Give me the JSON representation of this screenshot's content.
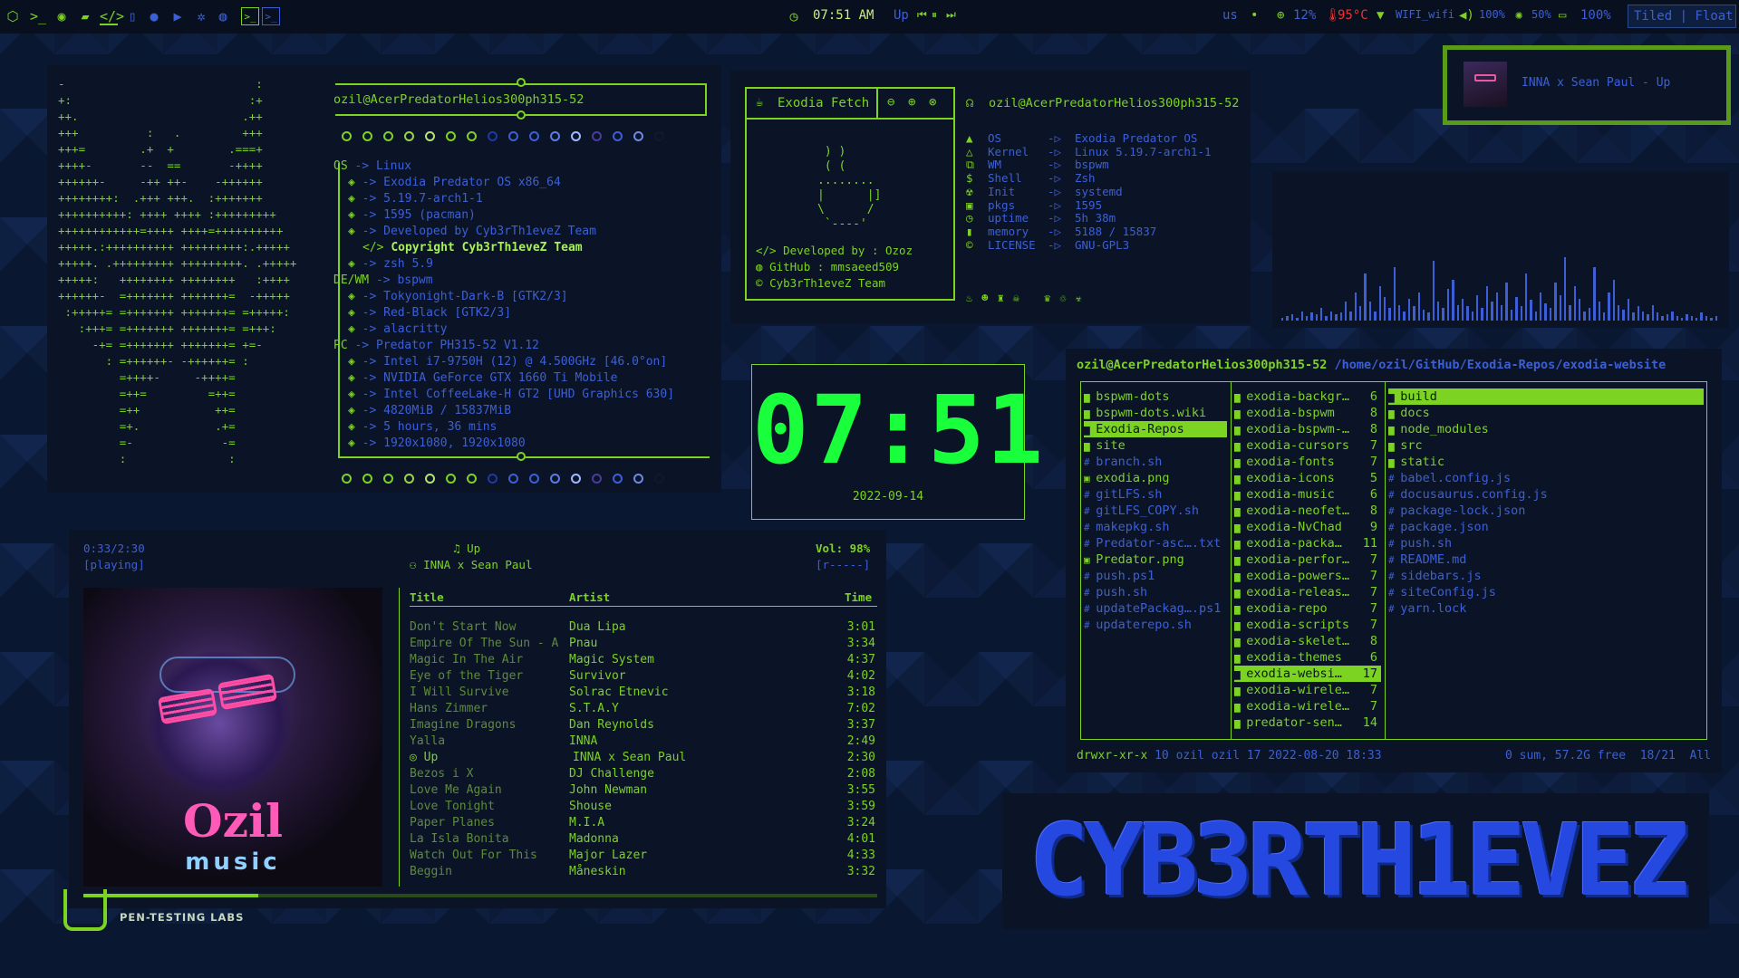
{
  "topbar": {
    "time": "07:51 AM",
    "media_title": "Up",
    "keyboard": "us",
    "cpu": "12%",
    "temp": "95°C",
    "wifi": "WIFI_wifi",
    "volume": "100%",
    "brightness": "50%",
    "battery": "100%",
    "layout_tiled": "Tiled",
    "layout_float": "Float",
    "layout_sep": "|"
  },
  "now_playing_popup": {
    "title": "INNA x Sean Paul - Up"
  },
  "neofetch": {
    "user_host": "ozil@AcerPredatorHelios300ph315-52",
    "os_label": "OS",
    "os_value": "-> Linux",
    "os_items": [
      "-> Exodia Predator OS x86_64",
      "-> 5.19.7-arch1-1",
      "-> 1595 (pacman)",
      "-> Developed by Cyb3rTh1eveZ Team",
      "Copyright Cyb3rTh1eveZ Team",
      "-> zsh 5.9"
    ],
    "de_label": "DE/WM",
    "de_value": "-> bspwm",
    "de_items": [
      "-> Tokyonight-Dark-B [GTK2/3]",
      "-> Red-Black [GTK2/3]",
      "-> alacritty"
    ],
    "pc_label": "PC",
    "pc_value": "-> Predator PH315-52 V1.12",
    "pc_items": [
      "-> Intel i7-9750H (12) @ 4.500GHz [46.0°on]",
      "-> NVIDIA GeForce GTX 1660 Ti Mobile",
      "-> Intel CoffeeLake-H GT2 [UHD Graphics 630]",
      "-> 4820MiB / 15837MiB",
      "-> 5 hours, 36 mins",
      "-> 1920x1080, 1920x1080"
    ],
    "ascii": [
      "-                            :",
      "+:                          :+",
      "++.                        .++",
      "+++          :   .         +++",
      "+++=        .+  +        .===+",
      "++++-       --  ==       -++++",
      "++++++-     -++ ++-    -++++++",
      "++++++++:  .+++ +++.  :+++++++",
      "++++++++++: ++++ ++++ :+++++++++",
      "++++++++++++=++++ ++++=++++++++++",
      "+++++.:++++++++++ +++++++++:.+++++",
      "+++++. .+++++++++ +++++++++. .+++++",
      "+++++:   ++++++++ ++++++++   :++++",
      "++++++-  =+++++++ +++++++=  -+++++",
      " :+++++= =+++++++ +++++++= =+++++:",
      "   :+++= =+++++++ +++++++= =+++:",
      "     -+= =+++++++ +++++++= +=-",
      "       : =++++++- -++++++= :",
      "         =++++-     -++++=",
      "         =++=         =++=",
      "         =++           ++=",
      "         =+.           .+=",
      "         =-             -=",
      "         :               :"
    ]
  },
  "exodia_fetch": {
    "title": "Exodia Fetch",
    "art": [
      " ) )",
      " ( (",
      "........",
      "|      |]",
      "\\      /",
      " `----'"
    ],
    "dev_label": "Developed by : Ozoz",
    "github_label": "GitHub : mmsaeed509",
    "team_label": "Cyb3rTh1eveZ Team",
    "user_host": "ozil@AcerPredatorHelios300ph315-52",
    "rows": [
      {
        "key": "OS",
        "val": "Exodia Predator OS"
      },
      {
        "key": "Kernel",
        "val": "Linux 5.19.7-arch1-1"
      },
      {
        "key": "WM",
        "val": "bspwm"
      },
      {
        "key": "Shell",
        "val": "Zsh"
      },
      {
        "key": "Init",
        "val": "systemd"
      },
      {
        "key": "pkgs",
        "val": "1595"
      },
      {
        "key": "uptime",
        "val": "5h 38m"
      },
      {
        "key": "memory",
        "val": "5188 / 15837"
      },
      {
        "key": "LICENSE",
        "val": "GNU-GPL3"
      }
    ],
    "arrow": "-▷"
  },
  "clock": {
    "time": "07:51",
    "date": "2022-09-14"
  },
  "visualizer": {
    "bars": [
      2,
      3,
      4,
      2,
      6,
      3,
      5,
      4,
      8,
      3,
      6,
      4,
      5,
      12,
      6,
      18,
      9,
      30,
      12,
      6,
      22,
      15,
      8,
      34,
      10,
      6,
      14,
      9,
      18,
      7,
      5,
      38,
      12,
      8,
      20,
      26,
      10,
      14,
      9,
      6,
      16,
      8,
      22,
      12,
      18,
      10,
      24,
      7,
      15,
      9,
      30,
      13,
      6,
      18,
      11,
      8,
      24,
      16,
      40,
      10,
      22,
      14,
      6,
      8,
      34,
      12,
      5,
      18,
      26,
      10,
      7,
      14,
      5,
      9,
      6,
      4,
      10,
      5,
      3,
      4,
      6,
      3,
      2,
      4,
      3,
      2,
      5,
      3,
      2,
      3
    ]
  },
  "player": {
    "position": "0:33/2:30",
    "state": "[playing]",
    "song": "Up",
    "artist": "INNA x Sean Paul",
    "volume": "Vol: 98%",
    "mode": "[r-----]",
    "col_title": "Title",
    "col_artist": "Artist",
    "col_time": "Time",
    "progress": 0.22,
    "songs": [
      {
        "title": "Don't Start Now",
        "artist": "Dua Lipa",
        "time": "3:01"
      },
      {
        "title": "Empire Of The Sun - A",
        "artist": "Pnau",
        "time": "3:34"
      },
      {
        "title": "Magic In The Air",
        "artist": "Magic System",
        "time": "4:37"
      },
      {
        "title": "Eye of the Tiger",
        "artist": "Survivor",
        "time": "4:02"
      },
      {
        "title": "I Will Survive",
        "artist": "Solrac Etnevic",
        "time": "3:18"
      },
      {
        "title": "Hans Zimmer",
        "artist": "S.T.A.Y",
        "time": "7:02"
      },
      {
        "title": "Imagine Dragons",
        "artist": "Dan Reynolds",
        "time": "3:37"
      },
      {
        "title": "Yalla",
        "artist": "INNA",
        "time": "2:49"
      },
      {
        "title": "Up",
        "artist": "INNA x Sean Paul",
        "time": "2:30"
      },
      {
        "title": "Bezos i X",
        "artist": "DJ Challenge",
        "time": "2:08"
      },
      {
        "title": "Love Me Again",
        "artist": "John Newman",
        "time": "3:55"
      },
      {
        "title": "Love Tonight",
        "artist": "Shouse",
        "time": "3:59"
      },
      {
        "title": "Paper Planes",
        "artist": "M.I.A",
        "time": "3:24"
      },
      {
        "title": "La Isla Bonita",
        "artist": "Madonna",
        "time": "4:01"
      },
      {
        "title": "Watch Out For This",
        "artist": "Major Lazer",
        "time": "4:33"
      },
      {
        "title": "Beggin",
        "artist": "Måneskin",
        "time": "3:32"
      }
    ],
    "album_line1": "Ozil",
    "album_line2": "music"
  },
  "logo": {
    "caption": "PEN-TESTING LABS"
  },
  "ranger": {
    "user_host": "ozil@AcerPredatorHelios300ph315-52",
    "path": "/home/ozil/GitHub/Exodia-Repos/exodia-website",
    "col1": [
      {
        "name": "bspwm-dots",
        "type": "dir"
      },
      {
        "name": "bspwm-dots.wiki",
        "type": "dir"
      },
      {
        "name": "Exodia-Repos",
        "type": "dir",
        "sel": true
      },
      {
        "name": "site",
        "type": "dir"
      },
      {
        "name": "branch.sh",
        "type": "file"
      },
      {
        "name": "exodia.png",
        "type": "img"
      },
      {
        "name": "gitLFS.sh",
        "type": "file"
      },
      {
        "name": "gitLFS_COPY.sh",
        "type": "file"
      },
      {
        "name": "makepkg.sh",
        "type": "file"
      },
      {
        "name": "Predator-asc….txt",
        "type": "file"
      },
      {
        "name": "Predator.png",
        "type": "img"
      },
      {
        "name": "push.ps1",
        "type": "file"
      },
      {
        "name": "push.sh",
        "type": "file"
      },
      {
        "name": "updatePackag….ps1",
        "type": "file"
      },
      {
        "name": "updaterepo.sh",
        "type": "file"
      }
    ],
    "col2": [
      {
        "name": "exodia-backgr…",
        "count": "6"
      },
      {
        "name": "exodia-bspwm",
        "count": "8"
      },
      {
        "name": "exodia-bspwm-…",
        "count": "8"
      },
      {
        "name": "exodia-cursors",
        "count": "7"
      },
      {
        "name": "exodia-fonts",
        "count": "7"
      },
      {
        "name": "exodia-icons",
        "count": "5"
      },
      {
        "name": "exodia-music",
        "count": "6"
      },
      {
        "name": "exodia-neofet…",
        "count": "8"
      },
      {
        "name": "exodia-NvChad",
        "count": "9"
      },
      {
        "name": "exodia-packa…",
        "count": "11"
      },
      {
        "name": "exodia-perfor…",
        "count": "7"
      },
      {
        "name": "exodia-powers…",
        "count": "7"
      },
      {
        "name": "exodia-releas…",
        "count": "7"
      },
      {
        "name": "exodia-repo",
        "count": "7"
      },
      {
        "name": "exodia-scripts",
        "count": "7"
      },
      {
        "name": "exodia-skelet…",
        "count": "8"
      },
      {
        "name": "exodia-themes",
        "count": "6"
      },
      {
        "name": "exodia-websi…",
        "count": "17",
        "sel": true
      },
      {
        "name": "exodia-wirele…",
        "count": "7"
      },
      {
        "name": "exodia-wirele…",
        "count": "7"
      },
      {
        "name": "predator-sen…",
        "count": "14"
      }
    ],
    "col3": [
      {
        "name": "build",
        "type": "dir",
        "sel": true
      },
      {
        "name": "docs",
        "type": "dir"
      },
      {
        "name": "node_modules",
        "type": "dir"
      },
      {
        "name": "src",
        "type": "dir"
      },
      {
        "name": "static",
        "type": "dir"
      },
      {
        "name": "babel.config.js",
        "type": "file"
      },
      {
        "name": "docusaurus.config.js",
        "type": "file"
      },
      {
        "name": "package-lock.json",
        "type": "file"
      },
      {
        "name": "package.json",
        "type": "file"
      },
      {
        "name": "push.sh",
        "type": "file"
      },
      {
        "name": "README.md",
        "type": "file"
      },
      {
        "name": "sidebars.js",
        "type": "file"
      },
      {
        "name": "siteConfig.js",
        "type": "file"
      },
      {
        "name": "yarn.lock",
        "type": "file"
      }
    ],
    "status_perm": "drwxr-xr-x",
    "status_info": "10 ozil ozil 17 2022-08-20 18:33",
    "status_right": "0 sum, 57.2G free  18/21  All"
  },
  "banner": {
    "text": "CYB3RTH1EVEZ"
  }
}
